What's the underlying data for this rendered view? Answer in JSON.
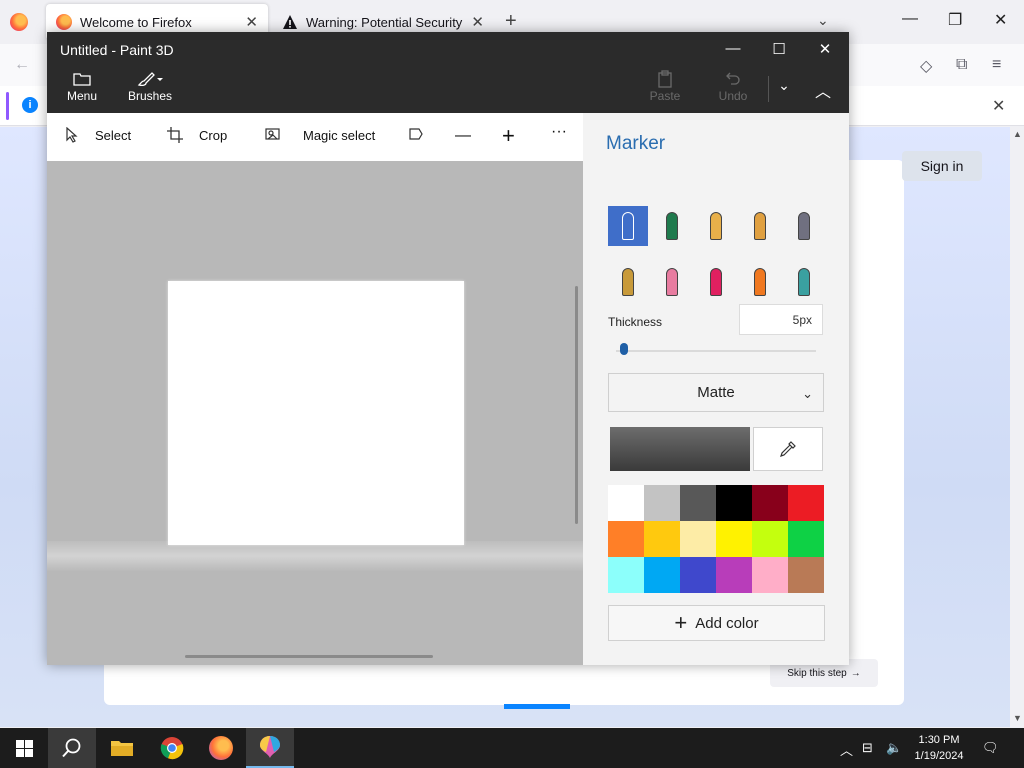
{
  "firefox": {
    "tabs": [
      {
        "title": "Welcome to Firefox"
      },
      {
        "title": "Warning: Potential Security Risk"
      }
    ],
    "new_tab": "+",
    "list_all_tabs": "⌄",
    "window_controls": {
      "minimize": "—",
      "restore": "❐",
      "close": "✕"
    },
    "nav": {
      "back": "←",
      "pocket": "◇",
      "extensions": "⧉",
      "menu": "≡"
    },
    "notification": {
      "info": "i",
      "close": "✕"
    },
    "page": {
      "sign_in": "Sign in",
      "skip_step": "Skip this step",
      "skip_arrow": "→",
      "progress": 0.33
    },
    "scroll": {
      "up": "▲",
      "down": "▼"
    }
  },
  "paint3d": {
    "title": "Untitled - Paint 3D",
    "window_controls": {
      "minimize": "—",
      "maximize": "☐",
      "close": "✕"
    },
    "ribbon": {
      "menu_label": "Menu",
      "brushes_label": "Brushes",
      "paste_label": "Paste",
      "undo_label": "Undo",
      "dropdown": "⌄",
      "collapse": "︿"
    },
    "toolbar": {
      "select_label": "Select",
      "crop_label": "Crop",
      "magic_select_label": "Magic select",
      "zoom_out": "—",
      "zoom_in": "+",
      "more": "···"
    },
    "side_panel": {
      "title": "Marker",
      "brushes": [
        {
          "name": "marker",
          "color": "#ffffff",
          "selected": true
        },
        {
          "name": "calligraphy-pen",
          "color": "#1f7a4d"
        },
        {
          "name": "oil-brush",
          "color": "#e8b04a"
        },
        {
          "name": "watercolor",
          "color": "#e0a040"
        },
        {
          "name": "pixel-pen",
          "color": "#707080"
        },
        {
          "name": "pencil",
          "color": "#c89a3a"
        },
        {
          "name": "eraser",
          "color": "#e87ca0"
        },
        {
          "name": "crayon",
          "color": "#e02060"
        },
        {
          "name": "spray-can",
          "color": "#f07820"
        },
        {
          "name": "fill",
          "color": "#3aa0a0"
        }
      ],
      "thickness_label": "Thickness",
      "thickness_value": "5px",
      "thickness_fraction": 0.02,
      "finish": "Matte",
      "finish_chevron": "⌄",
      "eyedropper": "✎",
      "palette": [
        "#ffffff",
        "#c3c3c3",
        "#585858",
        "#000000",
        "#88001b",
        "#ec1c24",
        "#ff7f27",
        "#ffc90e",
        "#fdeca6",
        "#fff200",
        "#c4ff0e",
        "#0ed145",
        "#8cfffb",
        "#00a8f3",
        "#3f48cc",
        "#b83dba",
        "#ffaec8",
        "#b97a56"
      ],
      "add_color_label": "Add color",
      "add_color_icon": "+"
    }
  },
  "taskbar": {
    "clock_time": "1:30 PM",
    "clock_date": "1/19/2024",
    "tray": {
      "chevron": "︿",
      "network": "⊟",
      "volume": "🔈",
      "notifications": "🗨"
    }
  }
}
